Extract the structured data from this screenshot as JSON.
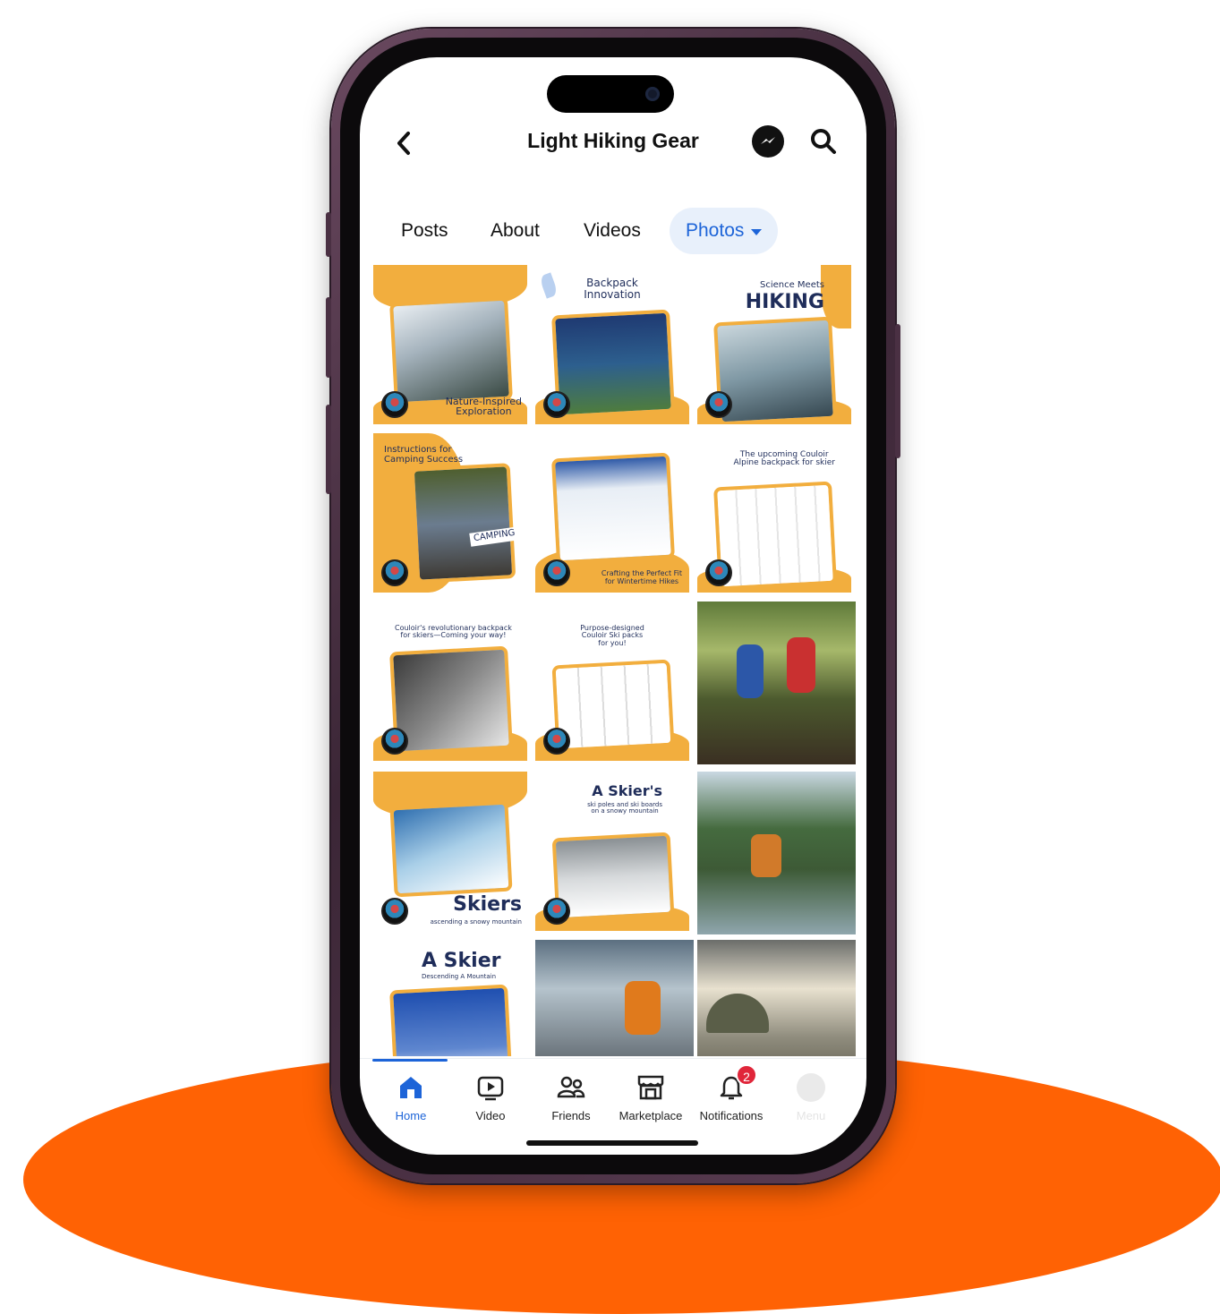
{
  "page": {
    "title": "Light Hiking Gear"
  },
  "tabs": [
    {
      "label": "Posts",
      "active": false
    },
    {
      "label": "About",
      "active": false
    },
    {
      "label": "Videos",
      "active": false
    },
    {
      "label": "Photos",
      "active": true
    }
  ],
  "photos": [
    {
      "kind": "promo",
      "caption": "Nature-Inspired\nExploration"
    },
    {
      "kind": "promo",
      "caption": "Backpack\nInnovation"
    },
    {
      "kind": "promo",
      "caption_small": "Science Meets",
      "caption_big": "HIKING"
    },
    {
      "kind": "promo",
      "caption": "Instructions for\nCamping Success",
      "sign": "CAMPING"
    },
    {
      "kind": "promo",
      "caption": "Crafting the Perfect Fit\nfor Wintertime Hikes"
    },
    {
      "kind": "promo",
      "caption": "The upcoming Couloir\nAlpine backpack for skier"
    },
    {
      "kind": "promo",
      "caption": "Couloir's revolutionary backpack\nfor skiers—Coming your way!"
    },
    {
      "kind": "promo",
      "caption": "Purpose-designed\nCouloir Ski packs\nfor you!"
    },
    {
      "kind": "photo",
      "scene": "couple hiking in forest"
    },
    {
      "kind": "promo",
      "caption_big": "Skiers",
      "caption_small": "ascending a snowy mountain"
    },
    {
      "kind": "promo",
      "caption_big": "A Skier's",
      "caption_small": "ski poles and ski boards\non a snowy mountain"
    },
    {
      "kind": "photo",
      "scene": "hiker resting by river"
    },
    {
      "kind": "promo",
      "caption_big": "A Skier",
      "caption_small": "Descending A Mountain"
    },
    {
      "kind": "photo",
      "scene": "hiker on mountain summit"
    },
    {
      "kind": "photo",
      "scene": "tent by lake at sunset"
    }
  ],
  "nav": [
    {
      "label": "Home",
      "icon": "home-icon",
      "active": true
    },
    {
      "label": "Video",
      "icon": "video-icon",
      "active": false
    },
    {
      "label": "Friends",
      "icon": "friends-icon",
      "active": false
    },
    {
      "label": "Marketplace",
      "icon": "marketplace-icon",
      "active": false
    },
    {
      "label": "Notifications",
      "icon": "bell-icon",
      "active": false,
      "badge": "2"
    },
    {
      "label": "Menu",
      "icon": "menu-avatar-icon",
      "active": false
    }
  ],
  "colors": {
    "accent": "#1d64d8",
    "promo_orange": "#f2ae3e",
    "background_ellipse": "#ff6204",
    "phone_frame": "#4a3043",
    "badge_red": "#e0263a"
  }
}
